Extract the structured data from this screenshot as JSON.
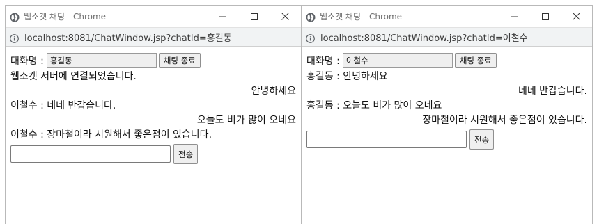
{
  "windows": [
    {
      "title": "웹소켓 채팅 - Chrome",
      "url": "localhost:8081/ChatWindow.jsp?chatId=홍길동",
      "name_label": "대화명 :",
      "name_value": "홍길동",
      "end_button": "채팅 종료",
      "messages": [
        {
          "text": "웹소켓 서버에 연결되었습니다.",
          "align": "left"
        },
        {
          "text": "안녕하세요",
          "align": "right"
        },
        {
          "text": "이철수 : 네네 반갑습니다.",
          "align": "left"
        },
        {
          "text": "오늘도 비가 많이 오네요",
          "align": "right"
        },
        {
          "text": "이철수 : 장마철이라 시원해서 좋은점이 있습니다.",
          "align": "left"
        }
      ],
      "send_button": "전송"
    },
    {
      "title": "웹소켓 채팅 - Chrome",
      "url": "localhost:8081/ChatWindow.jsp?chatId=이철수",
      "name_label": "대화명 :",
      "name_value": "이철수",
      "end_button": "채팅 종료",
      "messages": [
        {
          "text": "홍길동 : 안녕하세요",
          "align": "left"
        },
        {
          "text": "네네 반갑습니다.",
          "align": "right"
        },
        {
          "text": "홍길동 : 오늘도 비가 많이 오네요",
          "align": "left"
        },
        {
          "text": "장마철이라 시원해서 좋은점이 있습니다.",
          "align": "right"
        }
      ],
      "send_button": "전송"
    }
  ],
  "icons": {
    "tab": "globe-icon",
    "address": "info-icon",
    "controls": [
      "minimize-icon",
      "maximize-icon",
      "close-icon"
    ]
  }
}
